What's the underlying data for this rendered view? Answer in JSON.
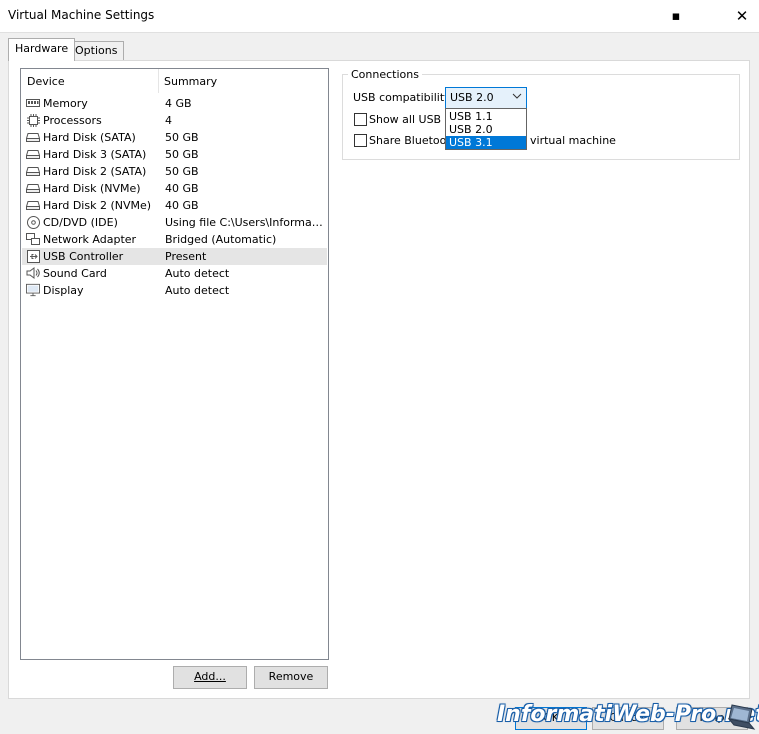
{
  "window": {
    "title": "Virtual Machine Settings"
  },
  "tabs": [
    {
      "label": "Hardware",
      "active": true
    },
    {
      "label": "Options",
      "active": false
    }
  ],
  "device_list": {
    "columns": [
      "Device",
      "Summary"
    ],
    "rows": [
      {
        "icon": "memory-icon",
        "name": "Memory",
        "summary": "4 GB"
      },
      {
        "icon": "processor-icon",
        "name": "Processors",
        "summary": "4"
      },
      {
        "icon": "hard-disk-icon",
        "name": "Hard Disk (SATA)",
        "summary": "50 GB"
      },
      {
        "icon": "hard-disk-icon",
        "name": "Hard Disk 3 (SATA)",
        "summary": "50 GB"
      },
      {
        "icon": "hard-disk-icon",
        "name": "Hard Disk 2 (SATA)",
        "summary": "50 GB"
      },
      {
        "icon": "hard-disk-icon",
        "name": "Hard Disk (NVMe)",
        "summary": "40 GB"
      },
      {
        "icon": "hard-disk-icon",
        "name": "Hard Disk 2 (NVMe)",
        "summary": "40 GB"
      },
      {
        "icon": "cd-dvd-icon",
        "name": "CD/DVD (IDE)",
        "summary": "Using file C:\\Users\\Informati..."
      },
      {
        "icon": "network-adapter-icon",
        "name": "Network Adapter",
        "summary": "Bridged (Automatic)"
      },
      {
        "icon": "usb-icon",
        "name": "USB Controller",
        "summary": "Present",
        "selected": true
      },
      {
        "icon": "speaker-icon",
        "name": "Sound Card",
        "summary": "Auto detect"
      },
      {
        "icon": "monitor-icon",
        "name": "Display",
        "summary": "Auto detect"
      }
    ],
    "add_label": "Add...",
    "remove_label": "Remove"
  },
  "connections": {
    "group_label": "Connections",
    "usb_compat_label": "USB compatibility:",
    "usb_compat_value": "USB 2.0",
    "dropdown_options": [
      "USB 1.1",
      "USB 2.0",
      "USB 3.1"
    ],
    "highlighted_option": "USB 3.1",
    "show_all_label": "Show all USB inp",
    "share_bt_label_start": "Share Bluetooth",
    "share_bt_label_end": "virtual machine"
  },
  "footer": {
    "ok_label": "OK",
    "cancel_label": "Cancel",
    "help_label": "Help"
  },
  "watermark": {
    "text": "InformatiWeb-Pro.net"
  },
  "colors": {
    "accent": "#0078d7",
    "selected_row": "#e5e5e5"
  }
}
